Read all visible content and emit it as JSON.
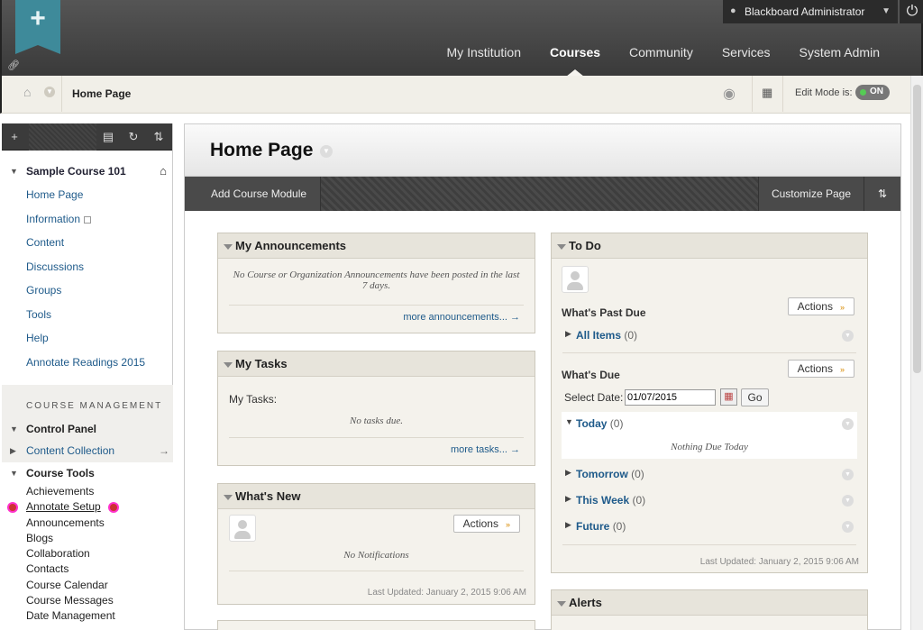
{
  "header": {
    "user": "Blackboard Administrator",
    "nav": [
      "My Institution",
      "Courses",
      "Community",
      "Services",
      "System Admin"
    ],
    "active_nav": "Courses"
  },
  "breadcrumb": {
    "title": "Home Page",
    "edit_mode_label": "Edit Mode is:",
    "edit_mode_value": "ON"
  },
  "left": {
    "course_name": "Sample Course 101",
    "links": [
      "Home Page",
      "Information",
      "Content",
      "Discussions",
      "Groups",
      "Tools",
      "Help",
      "Annotate Readings 2015"
    ],
    "course_management": "COURSE MANAGEMENT",
    "control_panel": "Control Panel",
    "content_collection": "Content Collection",
    "course_tools": "Course Tools",
    "tools": [
      "Achievements",
      "Annotate Setup",
      "Announcements",
      "Blogs",
      "Collaboration",
      "Contacts",
      "Course Calendar",
      "Course Messages",
      "Date Management"
    ]
  },
  "main": {
    "title": "Home Page",
    "add_module": "Add Course Module",
    "customize": "Customize Page"
  },
  "announcements": {
    "title": "My Announcements",
    "empty": "No Course or Organization Announcements have been posted in the last 7 days.",
    "more": "more announcements...  →"
  },
  "tasks": {
    "title": "My Tasks",
    "label": "My Tasks:",
    "empty": "No tasks due.",
    "more": "more tasks...  →"
  },
  "whatsnew": {
    "title": "What's New",
    "actions": "Actions",
    "empty": "No Notifications",
    "updated": "Last Updated: January 2, 2015 9:06 AM"
  },
  "todo": {
    "title": "To Do",
    "past_due": "What's Past Due",
    "actions": "Actions",
    "all_items": "All Items",
    "all_items_count": "(0)",
    "whats_due": "What's Due",
    "select_date": "Select Date:",
    "date_value": "01/07/2015",
    "go": "Go",
    "today": "Today",
    "today_count": "(0)",
    "nothing_today": "Nothing Due Today",
    "tomorrow": "Tomorrow",
    "tomorrow_count": "(0)",
    "this_week": "This Week",
    "this_week_count": "(0)",
    "future": "Future",
    "future_count": "(0)",
    "updated": "Last Updated: January 2, 2015 9:06 AM"
  },
  "alerts": {
    "title": "Alerts"
  }
}
